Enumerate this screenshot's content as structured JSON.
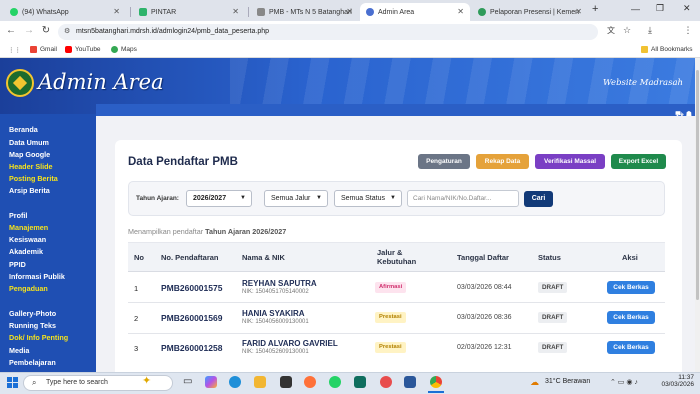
{
  "browser": {
    "tabs": [
      {
        "label": "(94) WhatsApp",
        "color": "#25d366",
        "active": false
      },
      {
        "label": "PINTAR",
        "color": "#2fb36b",
        "active": false
      },
      {
        "label": "PMB - MTs N 5 Batanghari",
        "color": "#888888",
        "active": false
      },
      {
        "label": "Admin Area",
        "color": "#4a6fd0",
        "active": true
      },
      {
        "label": "Pelaporan Presensi | Kemen",
        "color": "#2f9b5a",
        "active": false
      }
    ],
    "new_tab": "+",
    "url": "mtsn5batanghari.mdrsh.id/admlogin24/pmb_data_peserta.php",
    "bookmarks": [
      "Gmail",
      "YouTube",
      "Maps"
    ],
    "all_bookmarks": "All Bookmarks"
  },
  "header": {
    "title": "Admin Area",
    "subtitle": "Website Madrasah"
  },
  "sidebar": {
    "group1": [
      {
        "label": "Beranda",
        "highlight": false
      },
      {
        "label": "Data Umum",
        "highlight": false
      },
      {
        "label": "Map Google",
        "highlight": false
      },
      {
        "label": "Header Slide",
        "highlight": true
      },
      {
        "label": "Posting Berita",
        "highlight": true
      },
      {
        "label": "Arsip Berita",
        "highlight": false
      }
    ],
    "group2": [
      {
        "label": "Profil",
        "highlight": false
      },
      {
        "label": "Manajemen",
        "highlight": true
      },
      {
        "label": "Kesiswaan",
        "highlight": false
      },
      {
        "label": "Akademik",
        "highlight": false
      },
      {
        "label": "PPID",
        "highlight": false
      },
      {
        "label": "Informasi Publik",
        "highlight": false
      },
      {
        "label": "Pengaduan",
        "highlight": true
      }
    ],
    "group3": [
      {
        "label": "Gallery-Photo",
        "highlight": false
      },
      {
        "label": "Running Teks",
        "highlight": false
      },
      {
        "label": "Dok/ Info Penting",
        "highlight": true
      },
      {
        "label": "Media",
        "highlight": false
      },
      {
        "label": "Pembelajaran",
        "highlight": false
      }
    ]
  },
  "page": {
    "title": "Data Pendaftar PMB",
    "buttons": {
      "pengaturan": "Pengaturan",
      "rekap": "Rekap Data",
      "verifikasi": "Verifikasi Massal",
      "export": "Export Excel"
    },
    "filter": {
      "tahun_label": "Tahun Ajaran:",
      "tahun_value": "2026/2027",
      "jalur_value": "Semua Jalur",
      "status_value": "Semua Status",
      "search_placeholder": "Cari Nama/NIK/No.Daftar...",
      "cari": "Cari"
    },
    "showing_prefix": "Menampilkan pendaftar",
    "showing_value": "Tahun Ajaran 2026/2027"
  },
  "table": {
    "headers": {
      "no": "No",
      "no_pendaftaran": "No. Pendaftaran",
      "nama_nik": "Nama & NIK",
      "jalur1": "Jalur &",
      "jalur2": "Kebutuhan",
      "tanggal": "Tanggal Daftar",
      "status": "Status",
      "aksi": "Aksi"
    },
    "rows": [
      {
        "no": "1",
        "no_pendaftaran": "PMB260001575",
        "nama": "REYHAN SAPUTRA",
        "nik": "NIK: 1504051705140002",
        "jalur": "Afirmasi",
        "tanggal": "03/03/2026 08:44",
        "status": "DRAFT",
        "aksi": "Cek Berkas"
      },
      {
        "no": "2",
        "no_pendaftaran": "PMB260001569",
        "nama": "HANIA SYAKIRA",
        "nik": "NIK: 1504056009130001",
        "jalur": "Prestasi",
        "tanggal": "03/03/2026 08:36",
        "status": "DRAFT",
        "aksi": "Cek Berkas"
      },
      {
        "no": "3",
        "no_pendaftaran": "PMB260001258",
        "nama": "FARID ALVARO GAVRIEL",
        "nik": "NIK: 1504052609130001",
        "jalur": "Prestasi",
        "tanggal": "02/03/2026 12:31",
        "status": "DRAFT",
        "aksi": "Cek Berkas"
      }
    ]
  },
  "taskbar": {
    "search_placeholder": "Type here to search",
    "weather": "31°C  Berawan",
    "time": "11:37",
    "date": "03/03/2026"
  },
  "colors": {
    "btn_pengaturan": "#6b7586",
    "btn_rekap": "#e5a23a",
    "btn_verifikasi": "#7a3fc4",
    "btn_export": "#1f8a4c"
  }
}
